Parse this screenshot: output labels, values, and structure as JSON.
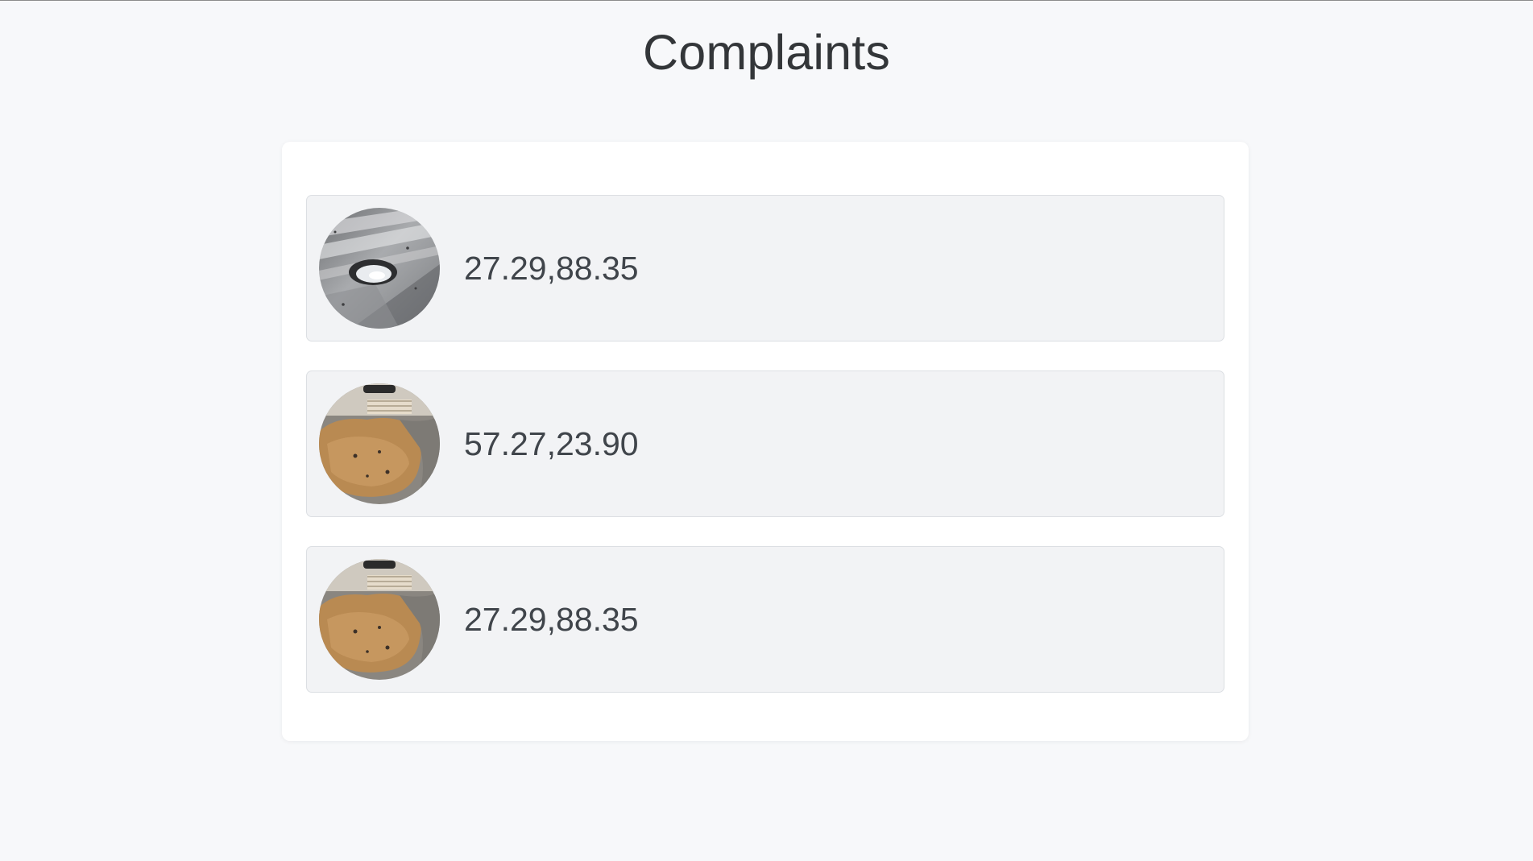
{
  "page": {
    "title": "Complaints"
  },
  "complaints": [
    {
      "coords": "27.29,88.35",
      "image_icon": "pothole-wet-asphalt-photo"
    },
    {
      "coords": "57.27,23.90",
      "image_icon": "muddy-pothole-photo"
    },
    {
      "coords": "27.29,88.35",
      "image_icon": "muddy-pothole-photo"
    }
  ],
  "colors": {
    "background": "#f7f8fa",
    "card": "#ffffff",
    "item_background": "#f2f3f5",
    "item_border": "#dcdfe3",
    "text": "#40454b"
  }
}
